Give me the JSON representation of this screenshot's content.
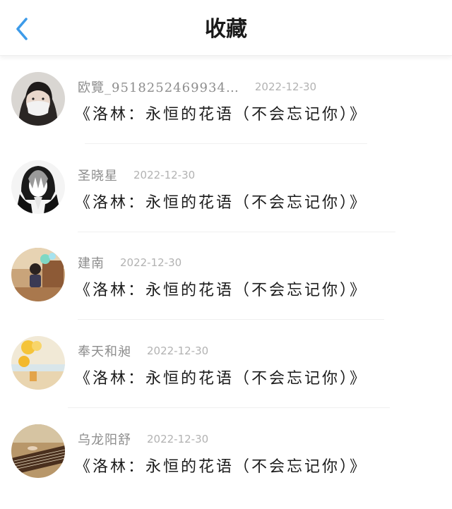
{
  "header": {
    "title": "收藏",
    "back_icon": "chevron-left-icon",
    "accent": "#3d9be9"
  },
  "items": [
    {
      "name": "欧覽_9518252469934…",
      "date": "2022-12-30",
      "post": "《洛林：永恒的花语（不会忘记你）》",
      "avatar": "person-with-mask-avatar"
    },
    {
      "name": "圣晓星",
      "date": "2022-12-30",
      "post": "《洛林：永恒的花语（不会忘记你）》",
      "avatar": "anime-character-avatar"
    },
    {
      "name": "建南",
      "date": "2022-12-30",
      "post": "《洛林：永恒的花语（不会忘记你）》",
      "avatar": "child-photo-avatar"
    },
    {
      "name": "奉天和昶",
      "date": "2022-12-30",
      "post": "《洛林：永恒的花语（不会忘记你）》",
      "avatar": "beach-balloons-avatar"
    },
    {
      "name": "乌龙阳舒",
      "date": "2022-12-30",
      "post": "《洛林：永恒的花语（不会忘记你）》",
      "avatar": "guzheng-instrument-avatar"
    }
  ]
}
